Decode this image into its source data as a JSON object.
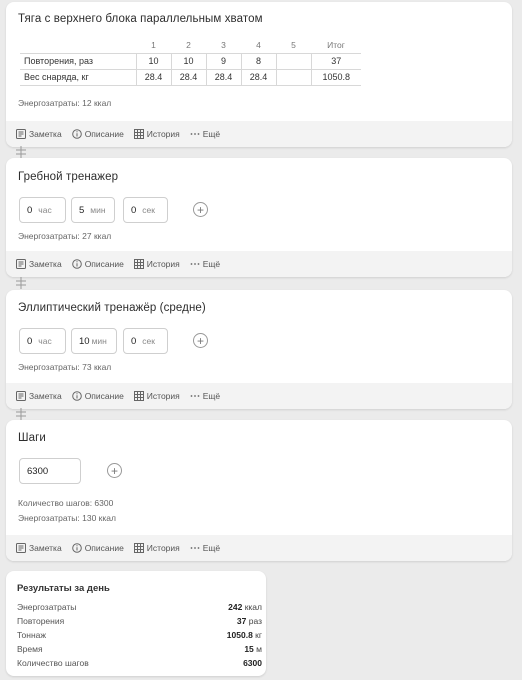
{
  "footer_actions": {
    "note": "Заметка",
    "description": "Описание",
    "history": "История",
    "more": "Ещё"
  },
  "exercise1": {
    "title": "Тяга с верхнего блока параллельным хватом",
    "set_numbers": [
      "1",
      "2",
      "3",
      "4",
      "5"
    ],
    "total_header": "Итог",
    "rows": [
      {
        "label": "Повторения, раз",
        "values": [
          "10",
          "10",
          "9",
          "8",
          ""
        ],
        "total": "37"
      },
      {
        "label": "Вес снаряда, кг",
        "values": [
          "28.4",
          "28.4",
          "28.4",
          "28.4",
          ""
        ],
        "total": "1050.8"
      }
    ],
    "energy": "Энергозатраты: 12 ккал"
  },
  "exercise2": {
    "title": "Гребной тренажер",
    "hours": "0",
    "hours_unit": "час",
    "minutes": "5",
    "minutes_unit": "мин",
    "seconds": "0",
    "seconds_unit": "сек",
    "energy": "Энергозатраты: 27 ккал"
  },
  "exercise3": {
    "title": "Эллиптический тренажёр (средне)",
    "hours": "0",
    "hours_unit": "час",
    "minutes": "10",
    "minutes_unit": "мин",
    "seconds": "0",
    "seconds_unit": "сек",
    "energy": "Энергозатраты: 73 ккал"
  },
  "exercise4": {
    "title": "Шаги",
    "steps": "6300",
    "steps_count": "Количество шагов: 6300",
    "energy": "Энергозатраты: 130 ккал"
  },
  "summary": {
    "title": "Результаты за день",
    "rows": [
      {
        "label": "Энергозатраты",
        "value": "242",
        "unit": "ккал"
      },
      {
        "label": "Повторения",
        "value": "37",
        "unit": "раз"
      },
      {
        "label": "Тоннаж",
        "value": "1050.8",
        "unit": "кг"
      },
      {
        "label": "Время",
        "value": "15",
        "unit": "м"
      },
      {
        "label": "Количество шагов",
        "value": "6300",
        "unit": ""
      }
    ]
  }
}
